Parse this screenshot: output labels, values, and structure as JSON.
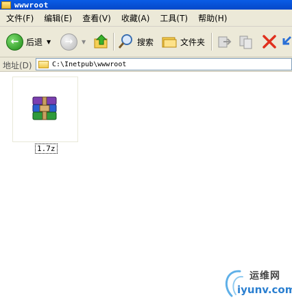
{
  "window": {
    "title": "wwwroot"
  },
  "menu": [
    {
      "label": "文件(F)"
    },
    {
      "label": "编辑(E)"
    },
    {
      "label": "查看(V)"
    },
    {
      "label": "收藏(A)"
    },
    {
      "label": "工具(T)"
    },
    {
      "label": "帮助(H)"
    }
  ],
  "toolbar": {
    "back_label": "后退",
    "search_label": "搜索",
    "folders_label": "文件夹"
  },
  "address": {
    "label": "地址(D)",
    "value": "C:\\Inetpub\\wwwroot"
  },
  "files": [
    {
      "name": "1.7z",
      "icon": "winrar-archive-icon"
    }
  ],
  "watermark": {
    "line1": "运维网",
    "line2": "iyunv.com"
  }
}
